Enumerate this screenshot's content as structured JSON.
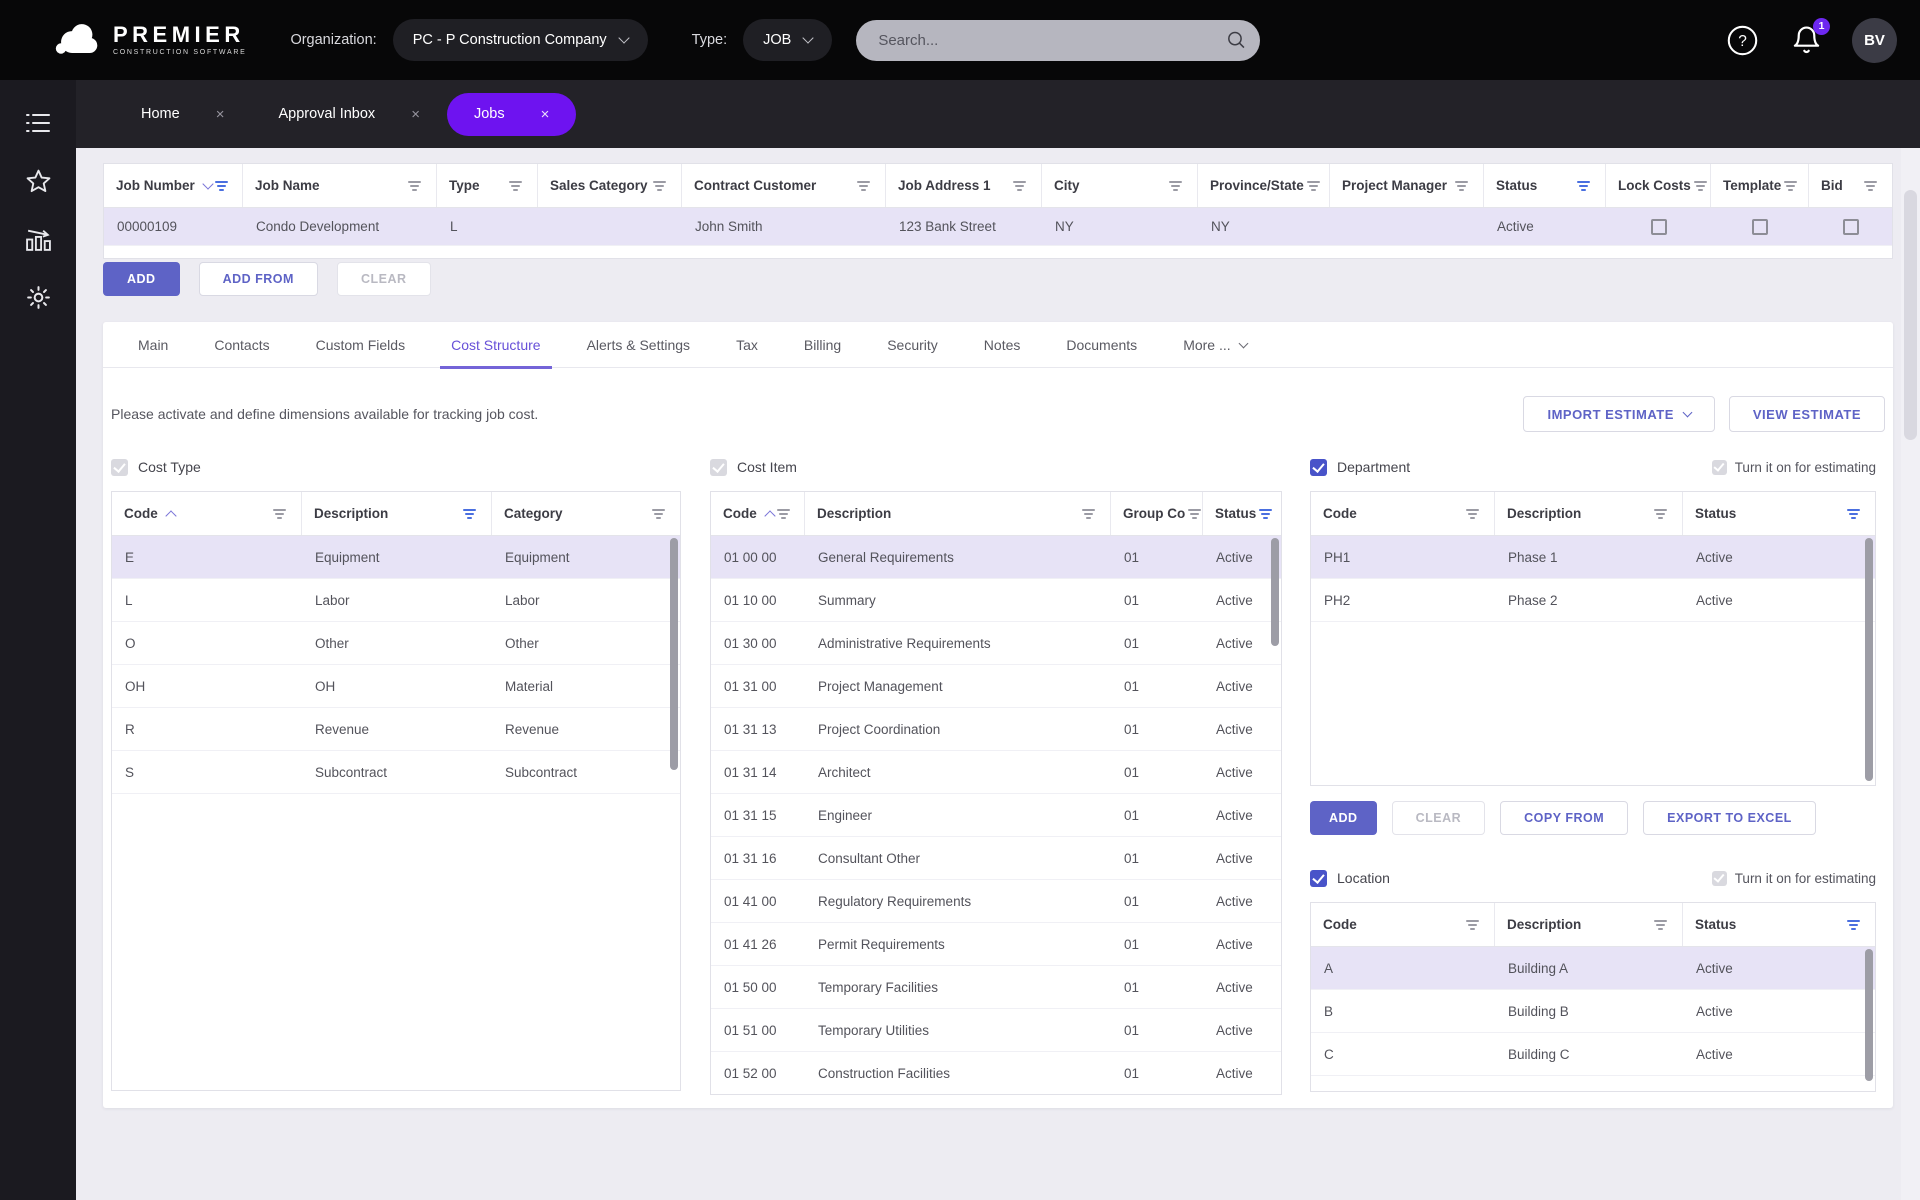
{
  "header": {
    "brand_name": "PREMIER",
    "brand_tagline": "CONSTRUCTION SOFTWARE",
    "organization_label": "Organization:",
    "organization_value": "PC - P Construction Company",
    "type_label": "Type:",
    "type_value": "JOB",
    "search_placeholder": "Search...",
    "notification_count": "1",
    "avatar_initials": "BV"
  },
  "glyphs": {
    "close": "×"
  },
  "workspace_tabs": [
    {
      "label": "Home"
    },
    {
      "label": "Approval Inbox"
    },
    {
      "label": "Jobs"
    }
  ],
  "jobs_grid": {
    "columns": [
      {
        "label": "Job Number",
        "sort": "desc",
        "filter": "blue"
      },
      {
        "label": "Job Name",
        "filter": "gray"
      },
      {
        "label": "Type",
        "filter": "gray"
      },
      {
        "label": "Sales Category",
        "filter": "gray"
      },
      {
        "label": "Contract Customer",
        "filter": "gray"
      },
      {
        "label": "Job Address 1",
        "filter": "gray"
      },
      {
        "label": "City",
        "filter": "gray"
      },
      {
        "label": "Province/State",
        "filter": "gray"
      },
      {
        "label": "Project Manager",
        "filter": "gray"
      },
      {
        "label": "Status",
        "filter": "blue"
      },
      {
        "label": "Lock Costs",
        "filter": "gray",
        "type": "checkbox"
      },
      {
        "label": "Template",
        "filter": "gray",
        "type": "checkbox"
      },
      {
        "label": "Bid",
        "filter": "gray",
        "type": "checkbox"
      }
    ],
    "rows": [
      [
        "00000109",
        "Condo Development",
        "L",
        "",
        "John Smith",
        "123 Bank Street",
        "NY",
        "NY",
        "",
        "Active",
        "",
        "",
        ""
      ]
    ],
    "selected": 0
  },
  "grid_actions": {
    "add": "ADD",
    "add_from": "ADD FROM",
    "clear": "CLEAR"
  },
  "detail_tabs": [
    "Main",
    "Contacts",
    "Custom Fields",
    "Cost Structure",
    "Alerts & Settings",
    "Tax",
    "Billing",
    "Security",
    "Notes",
    "Documents",
    "More ..."
  ],
  "cost_structure": {
    "description": "Please activate and define dimensions available for tracking job cost.",
    "import_estimate": "IMPORT ESTIMATE",
    "view_estimate": "VIEW ESTIMATE",
    "estimating_label": "Turn it on for estimating",
    "cost_type": {
      "title": "Cost Type",
      "columns": [
        {
          "label": "Code",
          "sort": "asc",
          "filter": "gray"
        },
        {
          "label": "Description",
          "filter": "blue"
        },
        {
          "label": "Category",
          "filter": "gray"
        }
      ],
      "rows": [
        [
          "E",
          "Equipment",
          "Equipment"
        ],
        [
          "L",
          "Labor",
          "Labor"
        ],
        [
          "O",
          "Other",
          "Other"
        ],
        [
          "OH",
          "OH",
          "Material"
        ],
        [
          "R",
          "Revenue",
          "Revenue"
        ],
        [
          "S",
          "Subcontract",
          "Subcontract"
        ]
      ],
      "selected": 0
    },
    "cost_item": {
      "title": "Cost Item",
      "columns": [
        {
          "label": "Code",
          "sort": "asc",
          "filter": "gray"
        },
        {
          "label": "Description",
          "filter": "gray"
        },
        {
          "label": "Group Co",
          "filter": "gray"
        },
        {
          "label": "Status",
          "filter": "blue"
        }
      ],
      "rows": [
        [
          "01 00 00",
          "General Requirements",
          "01",
          "Active"
        ],
        [
          "01 10 00",
          "Summary",
          "01",
          "Active"
        ],
        [
          "01 30 00",
          "Administrative Requirements",
          "01",
          "Active"
        ],
        [
          "01 31 00",
          "Project Management",
          "01",
          "Active"
        ],
        [
          "01 31 13",
          "Project Coordination",
          "01",
          "Active"
        ],
        [
          "01 31 14",
          "Architect",
          "01",
          "Active"
        ],
        [
          "01 31 15",
          "Engineer",
          "01",
          "Active"
        ],
        [
          "01 31 16",
          "Consultant Other",
          "01",
          "Active"
        ],
        [
          "01 41 00",
          "Regulatory Requirements",
          "01",
          "Active"
        ],
        [
          "01 41 26",
          "Permit Requirements",
          "01",
          "Active"
        ],
        [
          "01 50 00",
          "Temporary Facilities",
          "01",
          "Active"
        ],
        [
          "01 51 00",
          "Temporary Utilities",
          "01",
          "Active"
        ],
        [
          "01 52 00",
          "Construction Facilities",
          "01",
          "Active"
        ]
      ],
      "selected": 0
    },
    "department": {
      "title": "Department",
      "columns": [
        {
          "label": "Code",
          "filter": "gray"
        },
        {
          "label": "Description",
          "filter": "gray"
        },
        {
          "label": "Status",
          "filter": "blue"
        }
      ],
      "rows": [
        [
          "PH1",
          "Phase 1",
          "Active"
        ],
        [
          "PH2",
          "Phase 2",
          "Active"
        ]
      ],
      "selected": 0
    },
    "department_actions": {
      "add": "ADD",
      "clear": "CLEAR",
      "copy_from": "COPY FROM",
      "export": "EXPORT TO EXCEL"
    },
    "location": {
      "title": "Location",
      "columns": [
        {
          "label": "Code",
          "filter": "gray"
        },
        {
          "label": "Description",
          "filter": "gray"
        },
        {
          "label": "Status",
          "filter": "blue"
        }
      ],
      "rows": [
        [
          "A",
          "Building A",
          "Active"
        ],
        [
          "B",
          "Building B",
          "Active"
        ],
        [
          "C",
          "Building C",
          "Active"
        ]
      ],
      "selected": 0
    }
  },
  "colors": {
    "accent_purple": "#6e13f0",
    "accent_indigo": "#5e63c6",
    "filter_blue": "#4a6fe0",
    "selected_row": "#e7e3f6",
    "badge_purple": "#6d28f0"
  }
}
